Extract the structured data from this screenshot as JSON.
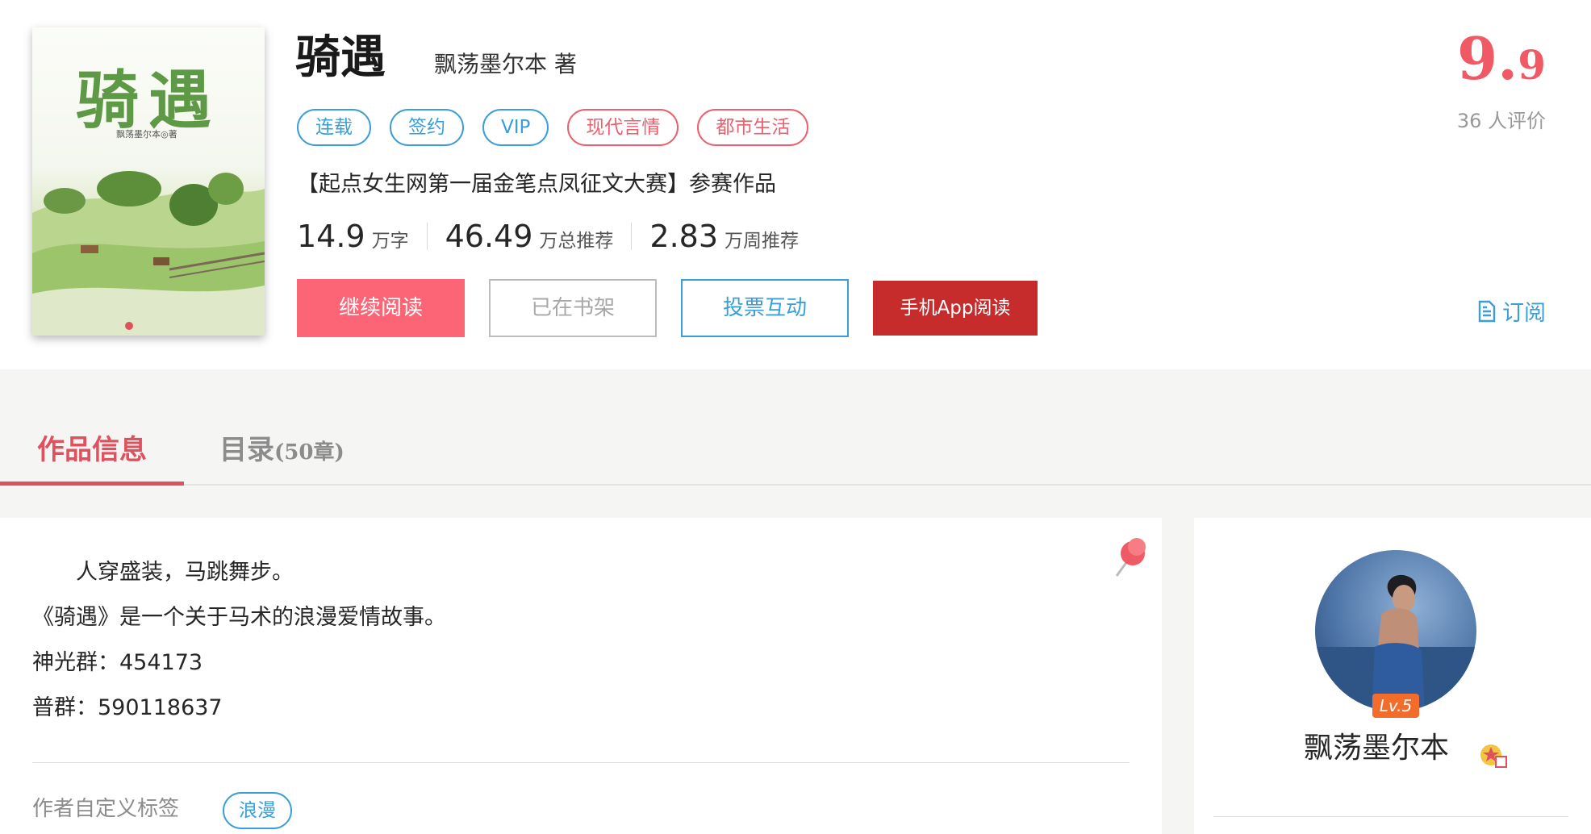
{
  "book": {
    "cover_title": "骑遇",
    "cover_author": "飘荡墨尔本◎著",
    "title": "骑遇",
    "author_line": "飘荡墨尔本 著",
    "tags": [
      {
        "label": "连载",
        "color": "#3a9ed9"
      },
      {
        "label": "签约",
        "color": "#3a9ed9"
      },
      {
        "label": "VIP",
        "color": "#3a9ed9"
      },
      {
        "label": "现代言情",
        "color": "#ec5f6d"
      },
      {
        "label": "都市生活",
        "color": "#ec5f6d"
      }
    ],
    "intro": "【起点女生网第一届金笔点凤征文大赛】参赛作品",
    "stats": [
      {
        "value": "14.9",
        "unit": "万字"
      },
      {
        "value": "46.49",
        "unit": "万总推荐"
      },
      {
        "value": "2.83",
        "unit": "万周推荐"
      }
    ]
  },
  "actions": {
    "read": "继续阅读",
    "shelf": "已在书架",
    "vote": "投票互动",
    "app": "手机App阅读",
    "subscribe": "订阅"
  },
  "rating": {
    "score_int": "9.",
    "score_dec": "9",
    "count_text": "36 人评价"
  },
  "tabs": {
    "info": "作品信息",
    "toc": "目录",
    "toc_count": "(50章)"
  },
  "description": {
    "lines": [
      "　　人穿盛装，马跳舞步。",
      "《骑遇》是一个关于马术的浪漫爱情故事。",
      "神光群：454173",
      "普群：590118637"
    ],
    "custom_tags_label": "作者自定义标签",
    "custom_tags": [
      "浪漫"
    ]
  },
  "author": {
    "name": "飘荡墨尔本",
    "level": "Lv.5"
  },
  "colors": {
    "accent_red": "#fb6575",
    "accent_blue": "#3a9ed9",
    "score_red": "#ef5a65",
    "app_red": "#c72c2c"
  },
  "icons": [
    "document-icon",
    "pushpin-icon",
    "author-badge-icon"
  ]
}
